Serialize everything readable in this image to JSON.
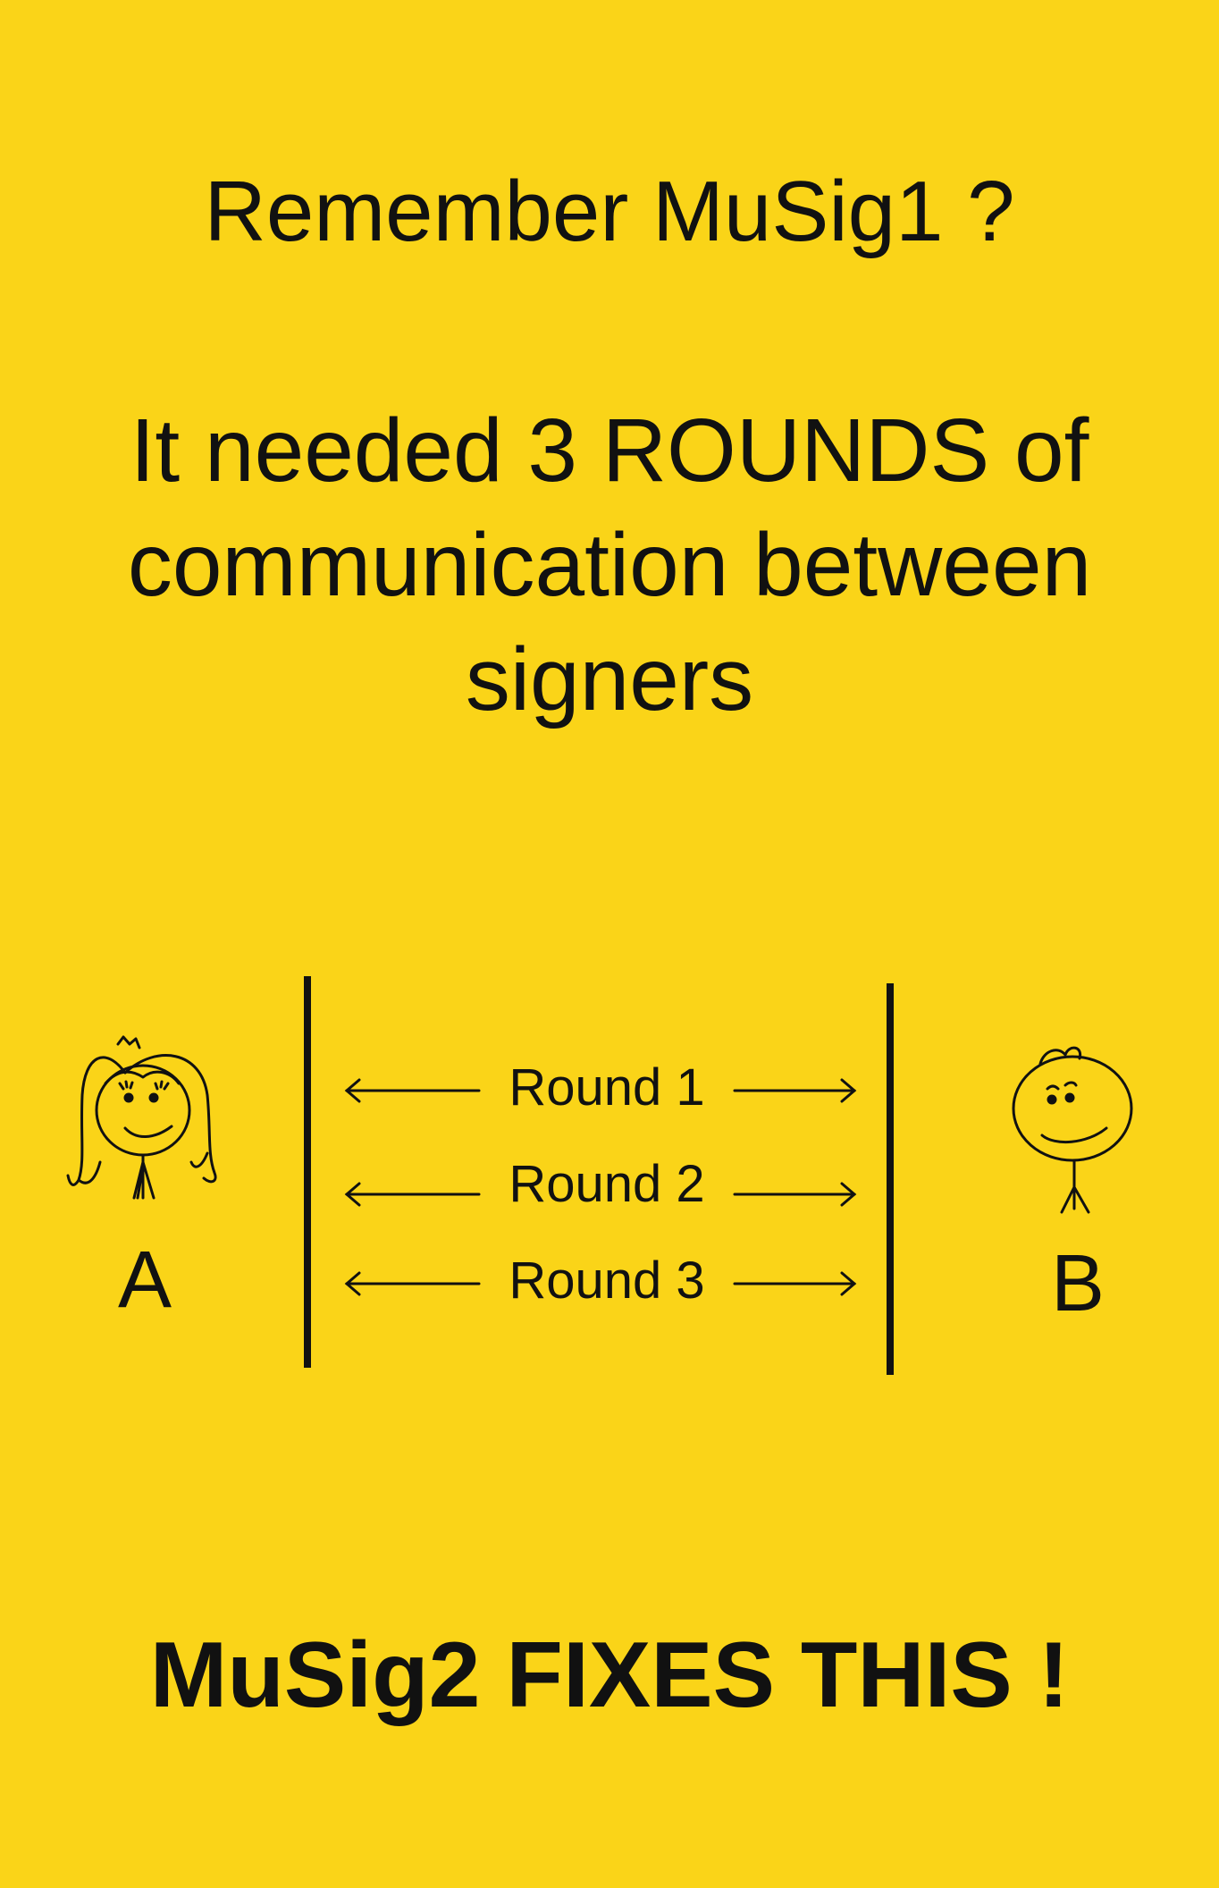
{
  "heading": "Remember MuSig1 ?",
  "statement_lines": [
    "It needed 3 ROUNDS of",
    "communication between",
    "signers"
  ],
  "diagram": {
    "party_a_label": "A",
    "party_b_label": "B",
    "rounds": [
      "Round 1",
      "Round 2",
      "Round 3"
    ]
  },
  "conclusion": "MuSig2 FIXES THIS !"
}
